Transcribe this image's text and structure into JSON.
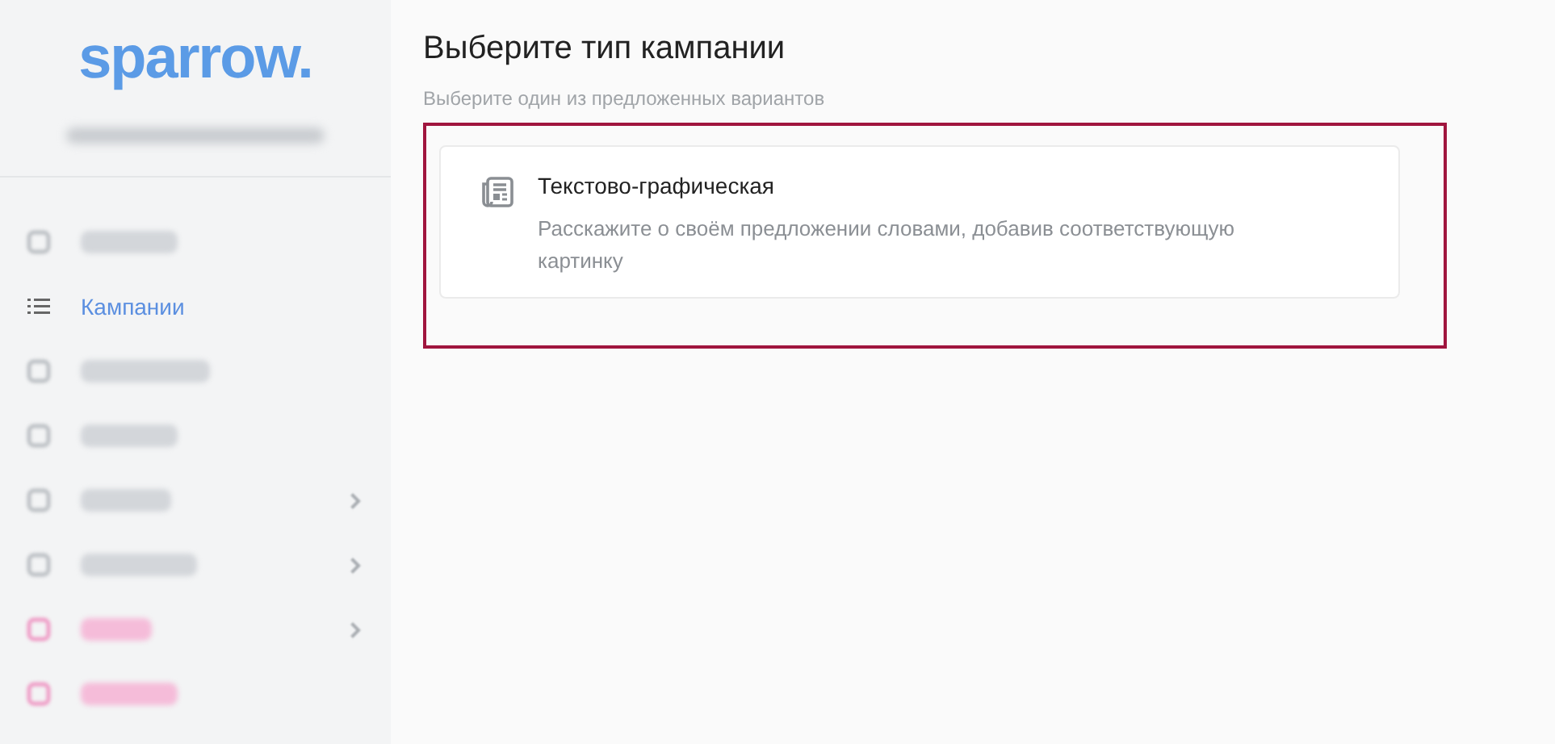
{
  "sidebar": {
    "logo": "sparrow.",
    "greeting": {
      "blurred": true
    },
    "items": [
      {
        "blurred": true,
        "chevron": false,
        "selected": false,
        "color": "#d3d6da"
      },
      {
        "blurred": false,
        "label": "Кампании",
        "chevron": false,
        "selected": true
      },
      {
        "blurred": true,
        "chevron": false,
        "selected": false,
        "color": "#d3d6da"
      },
      {
        "blurred": true,
        "chevron": false,
        "selected": false,
        "color": "#d3d6da"
      },
      {
        "blurred": true,
        "chevron": true,
        "selected": false,
        "color": "#d3d6da"
      },
      {
        "blurred": true,
        "chevron": true,
        "selected": false,
        "color": "#d3d6da"
      },
      {
        "blurred": true,
        "chevron": true,
        "selected": false,
        "color": "#f5bcd9"
      },
      {
        "blurred": true,
        "chevron": false,
        "selected": false,
        "color": "#f5bcd9"
      }
    ]
  },
  "main": {
    "title": "Выберите тип кампании",
    "subtitle": "Выберите один из предложенных вариантов",
    "highlighted": true,
    "options": [
      {
        "title": "Текстово-графическая",
        "description": "Расскажите о своём предложении словами, добавив соответствующую картинку"
      }
    ]
  }
}
